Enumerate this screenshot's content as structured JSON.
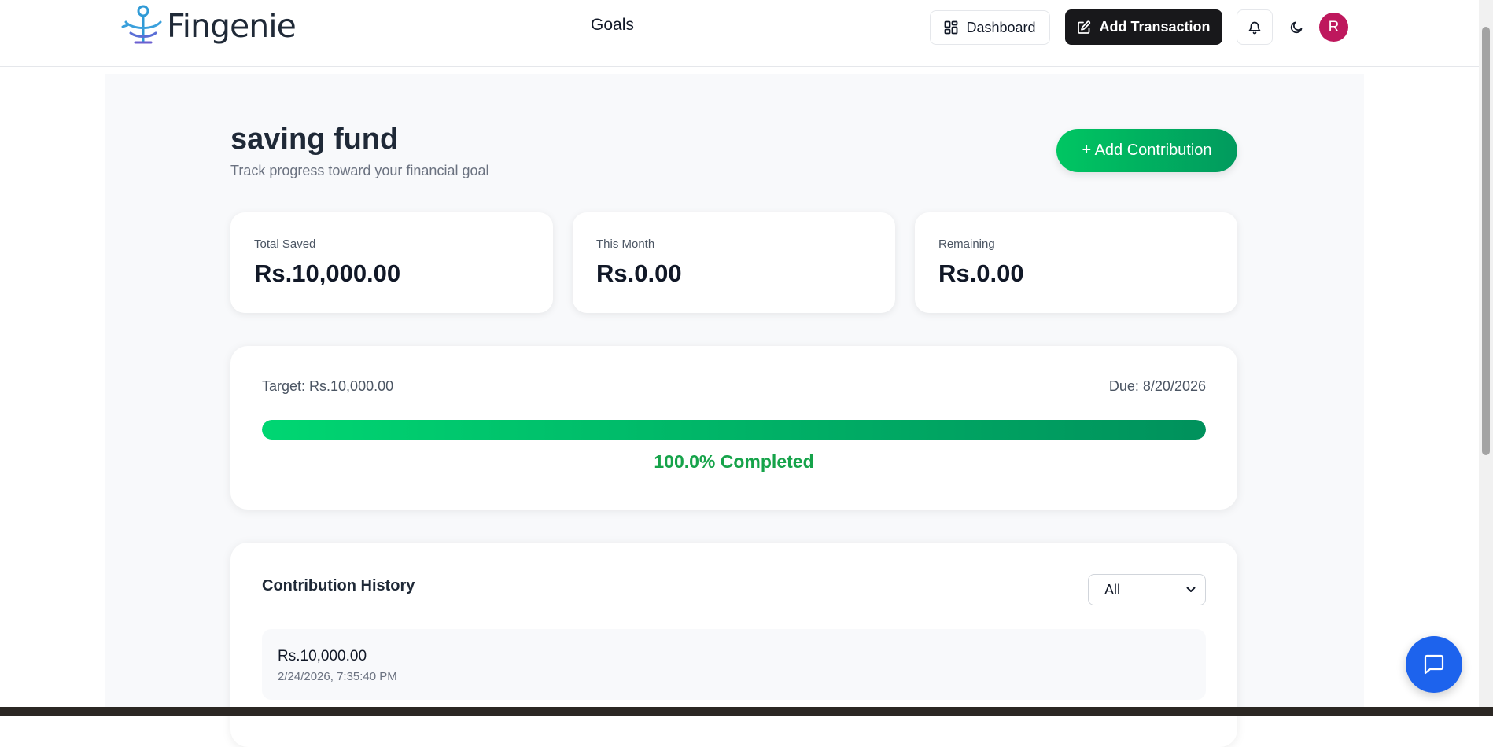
{
  "header": {
    "brand": "Fingenie",
    "nav_goals": "Goals",
    "dashboard_label": "Dashboard",
    "add_transaction_label": "Add Transaction",
    "avatar_initial": "R"
  },
  "goal": {
    "title": "saving fund",
    "subtitle": "Track progress toward your financial goal",
    "add_contribution_label": "+ Add Contribution"
  },
  "stats": [
    {
      "label": "Total Saved",
      "value": "Rs.10,000.00"
    },
    {
      "label": "This Month",
      "value": "Rs.0.00"
    },
    {
      "label": "Remaining",
      "value": "Rs.0.00"
    }
  ],
  "progress": {
    "target": "Target: Rs.10,000.00",
    "due": "Due: 8/20/2026",
    "percent": 100,
    "completed_text": "100.0% Completed"
  },
  "history": {
    "title": "Contribution History",
    "filter_selected": "All",
    "items": [
      {
        "amount": "Rs.10,000.00",
        "date": "2/24/2026, 7:35:40 PM"
      }
    ]
  },
  "colors": {
    "accent_green": "#16a34a",
    "avatar_bg": "#be185d",
    "chat_blue": "#1d63ed"
  },
  "icons": {
    "dashboard": "dashboard-grid-icon",
    "add_transaction": "edit-icon",
    "bell": "bell-icon",
    "theme": "moon-icon",
    "chat": "chat-bubble-icon",
    "select": "chevron-down-icon"
  }
}
